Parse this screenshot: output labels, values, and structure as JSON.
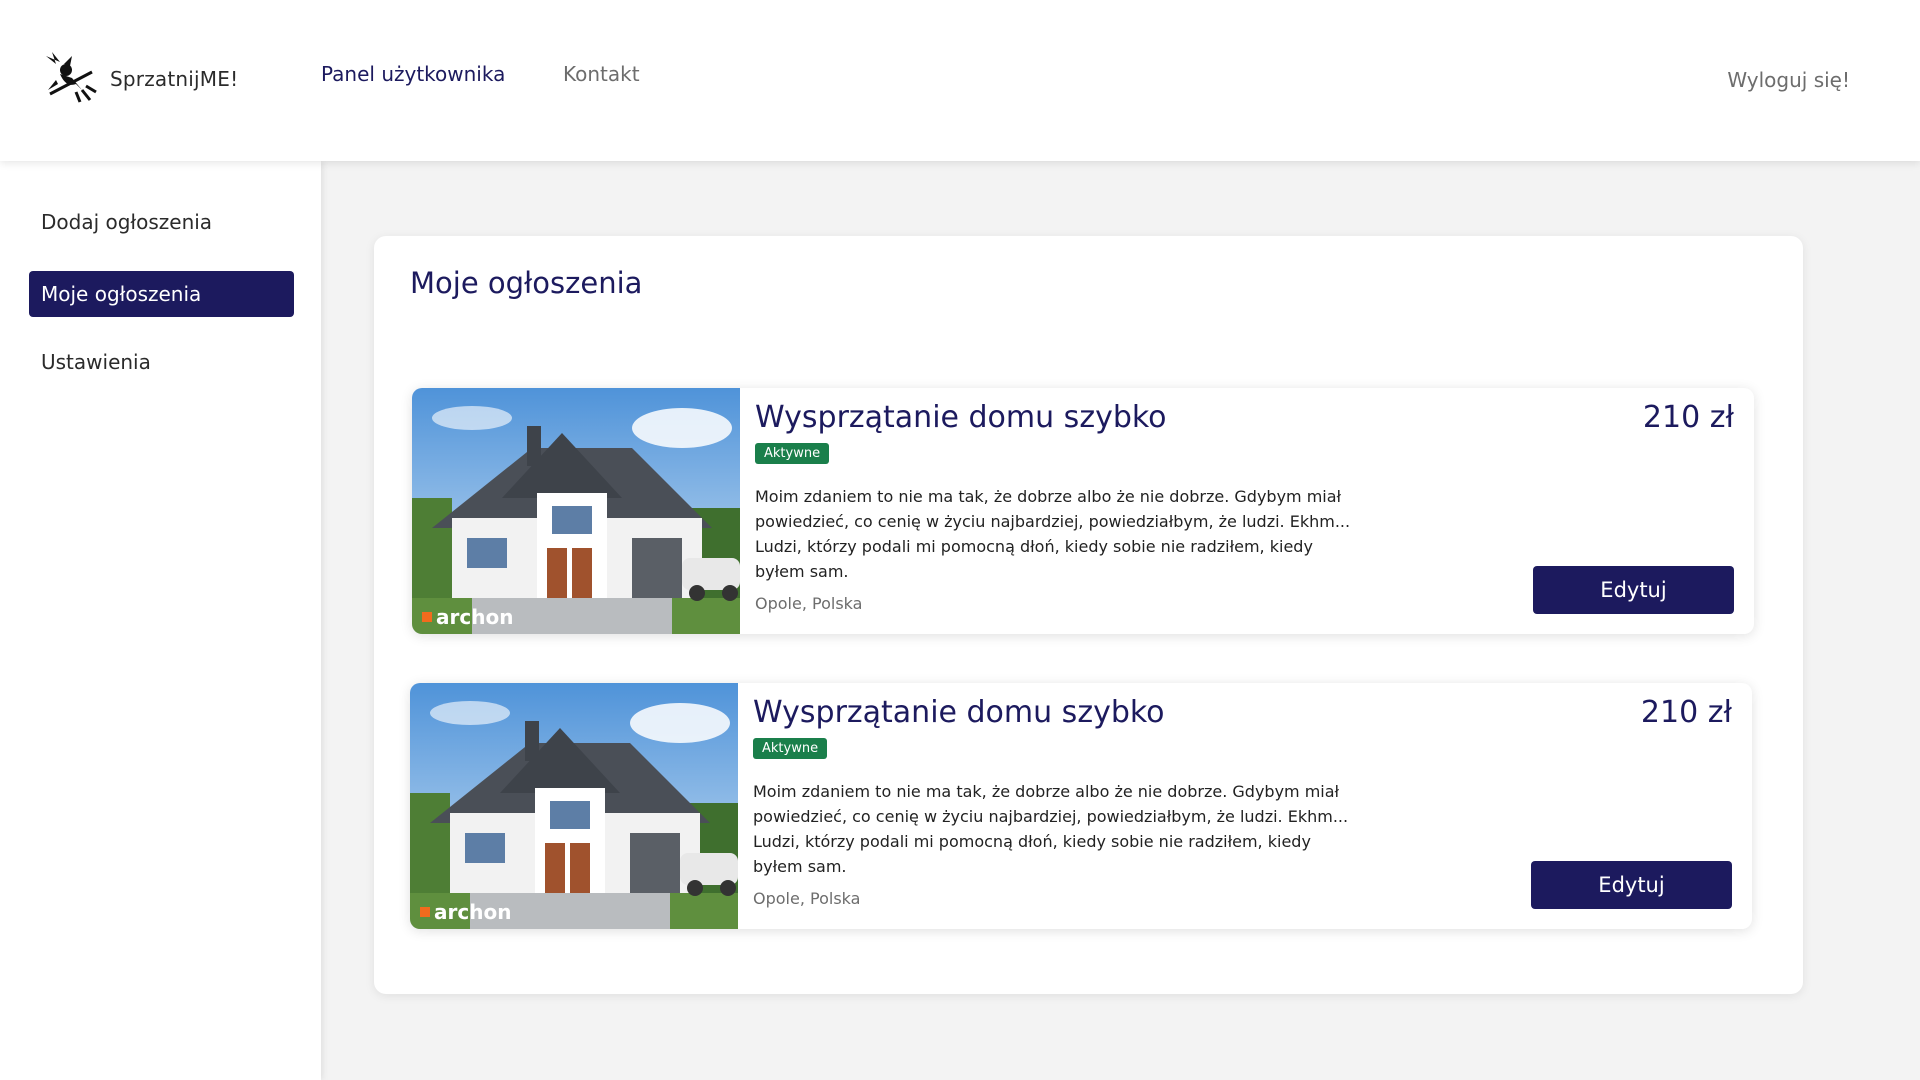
{
  "app": {
    "logo_text": "SprzatnijME!",
    "logo_icon": "witch-broom-icon"
  },
  "nav": {
    "panel_label": "Panel użytkownika",
    "contact_label": "Kontakt",
    "logout_label": "Wyloguj się!"
  },
  "sidebar": {
    "items": [
      {
        "label": "Dodaj ogłoszenia",
        "active": false
      },
      {
        "label": "Moje ogłoszenia",
        "active": true
      },
      {
        "label": "Ustawienia",
        "active": false
      }
    ]
  },
  "main": {
    "title": "Moje ogłoszenia",
    "listings": [
      {
        "title": "Wysprzątanie domu szybko",
        "price": "210 zł",
        "status": "Aktywne",
        "description": "Moim zdaniem to nie ma tak, że dobrze albo że nie dobrze. Gdybym miał powiedzieć, co cenię w życiu najbardziej, powiedziałbym, że ludzi. Ekhm... Ludzi, którzy podali mi pomocną dłoń, kiedy sobie nie radziłem, kiedy byłem sam.",
        "location": "Opole, Polska",
        "edit_label": "Edytuj",
        "image_watermark": "archon"
      },
      {
        "title": "Wysprzątanie domu szybko",
        "price": "210 zł",
        "status": "Aktywne",
        "description": "Moim zdaniem to nie ma tak, że dobrze albo że nie dobrze. Gdybym miał powiedzieć, co cenię w życiu najbardziej, powiedziałbym, że ludzi. Ekhm... Ludzi, którzy podali mi pomocną dłoń, kiedy sobie nie radziłem, kiedy byłem sam.",
        "location": "Opole, Polska",
        "edit_label": "Edytuj",
        "image_watermark": "archon"
      }
    ]
  },
  "colors": {
    "primary": "#1c1a5e",
    "badge_green": "#1a7f4b",
    "background": "#f3f3f3"
  }
}
